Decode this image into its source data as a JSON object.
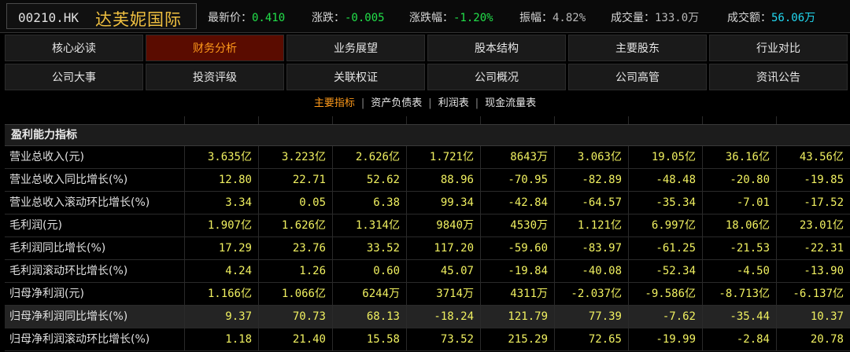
{
  "header": {
    "code": "00210.HK",
    "name": "达芙妮国际",
    "quotes": [
      {
        "label": "最新价：",
        "value": "0.410"
      },
      {
        "label": "涨跌：",
        "value": "-0.005"
      },
      {
        "label": "涨跌幅：",
        "value": "-1.20%"
      },
      {
        "label": "振幅：",
        "value": "4.82%"
      },
      {
        "label": "成交量：",
        "value": "133.0万"
      },
      {
        "label": "成交额：",
        "value": "56.06万"
      }
    ]
  },
  "tabs_row1": [
    "核心必读",
    "财务分析",
    "业务展望",
    "股本结构",
    "主要股东",
    "行业对比"
  ],
  "tabs_row2": [
    "公司大事",
    "投资评级",
    "关联权证",
    "公司概况",
    "公司高管",
    "资讯公告"
  ],
  "active_tab": "财务分析",
  "subnav": [
    "主要指标",
    "资产负债表",
    "利润表",
    "现金流量表"
  ],
  "active_subnav": "主要指标",
  "section_title": "盈利能力指标",
  "rows": [
    {
      "label": "营业总收入(元)",
      "values": [
        "3.635亿",
        "3.223亿",
        "2.626亿",
        "1.721亿",
        "8643万",
        "3.063亿",
        "19.05亿",
        "36.16亿",
        "43.56亿"
      ]
    },
    {
      "label": "营业总收入同比增长(%)",
      "values": [
        "12.80",
        "22.71",
        "52.62",
        "88.96",
        "-70.95",
        "-82.89",
        "-48.48",
        "-20.80",
        "-19.85"
      ]
    },
    {
      "label": "营业总收入滚动环比增长(%)",
      "values": [
        "3.34",
        "0.05",
        "6.38",
        "99.34",
        "-42.84",
        "-64.57",
        "-35.34",
        "-7.01",
        "-17.52"
      ]
    },
    {
      "label": "毛利润(元)",
      "values": [
        "1.907亿",
        "1.626亿",
        "1.314亿",
        "9840万",
        "4530万",
        "1.121亿",
        "6.997亿",
        "18.06亿",
        "23.01亿"
      ]
    },
    {
      "label": "毛利润同比增长(%)",
      "values": [
        "17.29",
        "23.76",
        "33.52",
        "117.20",
        "-59.60",
        "-83.97",
        "-61.25",
        "-21.53",
        "-22.31"
      ]
    },
    {
      "label": "毛利润滚动环比增长(%)",
      "values": [
        "4.24",
        "1.26",
        "0.60",
        "45.07",
        "-19.84",
        "-40.08",
        "-52.34",
        "-4.50",
        "-13.90"
      ]
    },
    {
      "label": "归母净利润(元)",
      "values": [
        "1.166亿",
        "1.066亿",
        "6244万",
        "3714万",
        "4311万",
        "-2.037亿",
        "-9.586亿",
        "-8.713亿",
        "-6.137亿"
      ]
    },
    {
      "label": "归母净利润同比增长(%)",
      "values": [
        "9.37",
        "70.73",
        "68.13",
        "-18.24",
        "121.79",
        "77.39",
        "-7.62",
        "-35.44",
        "10.37"
      ]
    },
    {
      "label": "归母净利润滚动环比增长(%)",
      "values": [
        "1.18",
        "21.40",
        "15.58",
        "73.52",
        "215.29",
        "72.65",
        "-19.99",
        "-2.84",
        "20.78"
      ]
    }
  ],
  "highlight_row": 7,
  "colors": {
    "name": "#f0c040",
    "value": "#f0f060",
    "active_tab_bg": "#5a0c00",
    "active_tab_text": "#ff9a1a",
    "down": "#22e04a",
    "amount": "#22d8f0"
  }
}
